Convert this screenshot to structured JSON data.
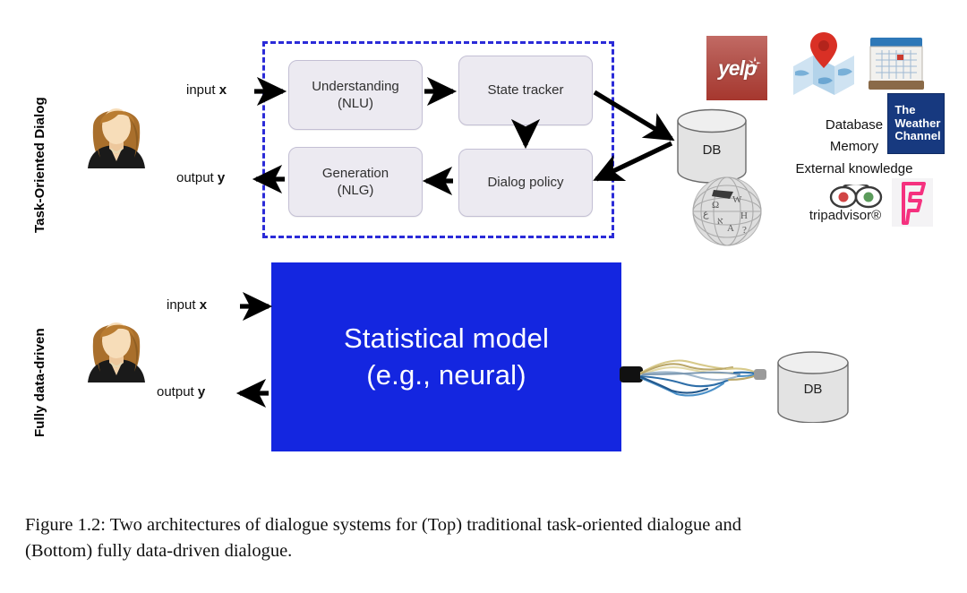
{
  "figure": {
    "rows": [
      {
        "id": "task-oriented",
        "label": "Task-Oriented Dialog"
      },
      {
        "id": "fully-data-driven",
        "label": "Fully data-driven"
      }
    ],
    "io": {
      "input_prefix": "input ",
      "input_var": "x",
      "output_prefix": "output ",
      "output_var": "y"
    },
    "pipeline_boxes": [
      {
        "id": "nlu",
        "line1": "Understanding",
        "line2": "(NLU)"
      },
      {
        "id": "state-tracker",
        "line1": "State tracker",
        "line2": ""
      },
      {
        "id": "nlg",
        "line1": "Generation",
        "line2": "(NLG)"
      },
      {
        "id": "dialog-policy",
        "line1": "Dialog policy",
        "line2": ""
      }
    ],
    "model_box": {
      "line1": "Statistical model",
      "line2": "(e.g., neural)",
      "color": "#1426e0"
    },
    "databases": [
      {
        "id": "db-top",
        "label": "DB"
      },
      {
        "id": "db-bottom",
        "label": "DB"
      }
    ],
    "knowledge_lines": [
      "Database",
      "Memory",
      "External knowledge"
    ],
    "logos": [
      {
        "id": "yelp",
        "name": "yelp-logo",
        "text": "yelp",
        "color": "#a6372e"
      },
      {
        "id": "map",
        "name": "map-pin-logo",
        "text": "",
        "color": "#d93025"
      },
      {
        "id": "calendar",
        "name": "calendar-logo",
        "text": "",
        "color": "#2b6cb0"
      },
      {
        "id": "weather",
        "name": "the-weather-channel-logo",
        "text": "The Weather Channel",
        "color": "#17397f"
      },
      {
        "id": "wikipedia",
        "name": "wikipedia-globe-logo",
        "text": "",
        "color": "#bfbfbf"
      },
      {
        "id": "tripadvisor",
        "name": "tripadvisor-logo",
        "text": "tripadvisor®",
        "color": "#1a1a1a"
      },
      {
        "id": "foursquare",
        "name": "foursquare-logo",
        "text": "",
        "color": "#f5317f"
      }
    ],
    "weather_logo_lines": [
      "The",
      "Weather",
      "Channel"
    ],
    "dashed_border_color": "#2b2bd8"
  },
  "caption": {
    "line1": "Figure 1.2: Two architectures of dialogue systems for (Top) traditional task-oriented dialogue and",
    "line2": "(Bottom) fully data-driven dialogue."
  }
}
